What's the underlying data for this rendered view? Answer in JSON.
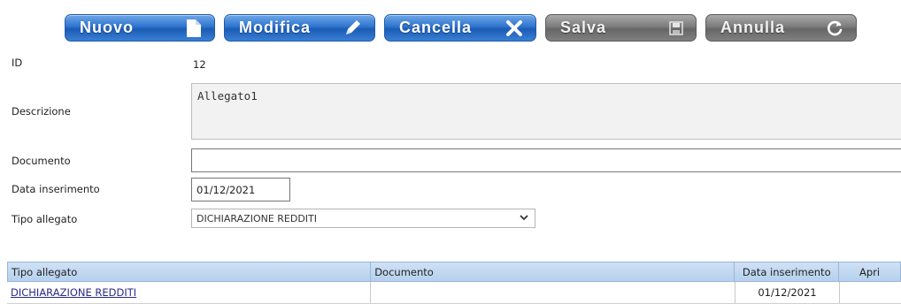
{
  "toolbar": {
    "nuovo": "Nuovo",
    "modifica": "Modifica",
    "cancella": "Cancella",
    "salva": "Salva",
    "annulla": "Annulla"
  },
  "form": {
    "id_label": "ID",
    "id_value": "12",
    "descrizione_label": "Descrizione",
    "descrizione_value": "Allegato1",
    "documento_label": "Documento",
    "documento_value": "",
    "data_label": "Data inserimento",
    "data_value": "01/12/2021",
    "tipo_label": "Tipo allegato",
    "tipo_value": "DICHIARAZIONE REDDITI"
  },
  "table": {
    "headers": [
      "Tipo allegato",
      "Documento",
      "Data inserimento",
      "Apri"
    ],
    "rows": [
      {
        "tipo": "DICHIARAZIONE REDDITI",
        "documento": "",
        "data": "01/12/2021",
        "apri": ""
      }
    ]
  },
  "colors": {
    "button_active": "#2f74cf",
    "button_disabled": "#7c7c7c",
    "header_bg": "#c4d9f2",
    "link": "#2a2a8a"
  }
}
